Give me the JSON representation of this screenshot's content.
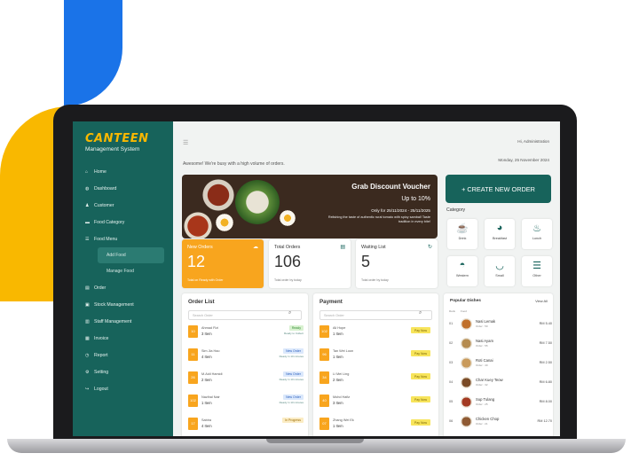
{
  "brand": {
    "title": "CANTEEN",
    "subtitle": "Management System"
  },
  "nav": {
    "home": "Home",
    "dashboard": "Dashboard",
    "customer": "Customer",
    "food_category": "Food Category",
    "food_menu": "Food Menu",
    "add_food": "Add Food",
    "manage_food": "Manage Food",
    "order": "Order",
    "stock": "Stock Management",
    "staff": "Staff Management",
    "invoice": "Invoice",
    "report": "Report",
    "setting": "Setting",
    "logout": "Logout"
  },
  "header": {
    "admin": "Hi, Administration",
    "welcome": "Awesome! We're busy with a high volume of orders.",
    "date": "Monday, 25 November 2024"
  },
  "banner": {
    "title": "Grab Discount Voucher",
    "discount": "Up to 10%",
    "validity": "Only for 25/11/2024 - 25/11/2025",
    "description": "Relishing the taste of authentic rural tomato with spicy sambal! Taste tradition in every bite!"
  },
  "create_order": "+ CREATE NEW ORDER",
  "category": {
    "title": "Category",
    "items": [
      {
        "label": "Drink",
        "icon": "cup-icon"
      },
      {
        "label": "Breakfast",
        "icon": "coffee-icon"
      },
      {
        "label": "Lunch",
        "icon": "noodle-icon"
      },
      {
        "label": "Western",
        "icon": "pizza-icon"
      },
      {
        "label": "Small",
        "icon": "bowl-icon"
      },
      {
        "label": "Other",
        "icon": "burger-icon"
      }
    ]
  },
  "stats": [
    {
      "title": "New Orders",
      "value": "12",
      "sub": "Total on Ready with Order",
      "icon": "cloud-icon"
    },
    {
      "title": "Total Orders",
      "value": "106",
      "sub": "Total order by today",
      "icon": "clipboard-icon"
    },
    {
      "title": "Waiting List",
      "value": "5",
      "sub": "Total order by today",
      "icon": "refresh-icon"
    }
  ],
  "order_list": {
    "title": "Order List",
    "search_placeholder": "Search Order",
    "rows": [
      {
        "num": "10",
        "name": "Ahmad Fizi",
        "items": "3 Item",
        "status": "Ready",
        "status_color": "#d8f1d0",
        "status_text": "#2f8a2f",
        "note": "Ready to Collect"
      },
      {
        "num": "11",
        "name": "Sim Jia Hao",
        "items": "4 Item",
        "status": "New Order",
        "status_color": "#dbe8fb",
        "status_text": "#2a5fbf",
        "note": "Ready in 10 minutes"
      },
      {
        "num": "26",
        "name": "M.Aidi Hamidi",
        "items": "2 Item",
        "status": "New Order",
        "status_color": "#dbe8fb",
        "status_text": "#2a5fbf",
        "note": "Ready in 10 minutes"
      },
      {
        "num": "102",
        "name": "Nazihal Nair",
        "items": "1 Item",
        "status": "New Order",
        "status_color": "#dbe8fb",
        "status_text": "#2a5fbf",
        "note": "Ready in 10 minutes"
      },
      {
        "num": "17",
        "name": "Sabira",
        "items": "4 Item",
        "status": "In Progress",
        "status_color": "#fbecc4",
        "status_text": "#9a6a00",
        "note": ""
      }
    ]
  },
  "payment": {
    "title": "Payment",
    "search_placeholder": "Search Order",
    "pay_label": "Pay Now",
    "rows": [
      {
        "num": "102",
        "name": "Ali Hope",
        "items": "1 Item"
      },
      {
        "num": "96",
        "name": "Tan Wei Loon",
        "items": "1 Item"
      },
      {
        "num": "34",
        "name": "Li Mei Ling",
        "items": "2 Item"
      },
      {
        "num": "40",
        "name": "Mohd Hafiz",
        "items": "3 Item"
      },
      {
        "num": "07",
        "name": "Zhang Wei Ek",
        "items": "1 Item"
      }
    ]
  },
  "popular": {
    "title": "Popular Dishes",
    "view_all": "View All",
    "col_rank": "Rank",
    "col_food": "Food",
    "rows": [
      {
        "rank": "01",
        "name": "Nasi Lemak",
        "order": "Order : 59",
        "price": "RM 5.40",
        "color": "#c0702a"
      },
      {
        "rank": "02",
        "name": "Nasi Ayam",
        "order": "Order : 55",
        "price": "RM 7.50",
        "color": "#b58b4f"
      },
      {
        "rank": "03",
        "name": "Roti Canai",
        "order": "Order : 40",
        "price": "RM 2.50",
        "color": "#c99a5a"
      },
      {
        "rank": "04",
        "name": "Char Kuey Teow",
        "order": "Order : 32",
        "price": "RM 6.80",
        "color": "#7a4a26"
      },
      {
        "rank": "05",
        "name": "Sup Tulang",
        "order": "Order : 25",
        "price": "RM 8.00",
        "color": "#a33a22"
      },
      {
        "rank": "06",
        "name": "Chicken Chop",
        "order": "Order : 21",
        "price": "RM 12.70",
        "color": "#8f5a33"
      }
    ]
  }
}
